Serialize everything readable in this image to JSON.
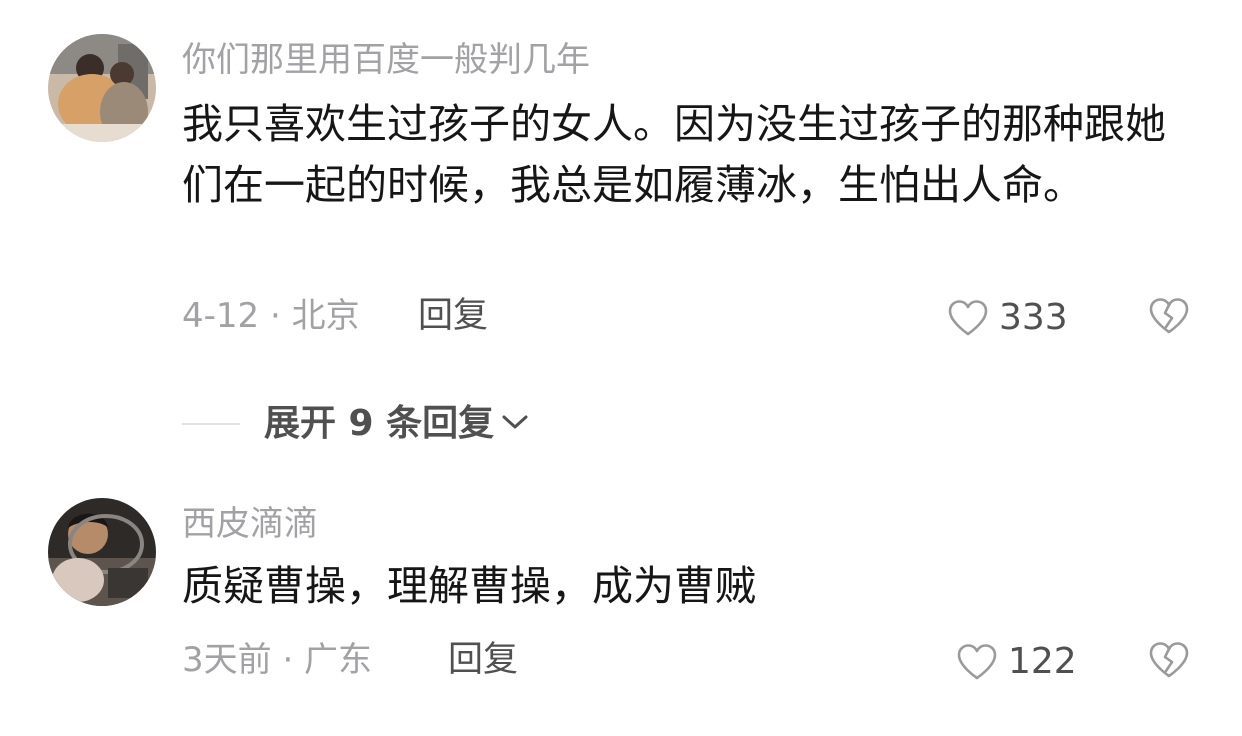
{
  "comments": [
    {
      "username": "你们那里用百度一般判几年",
      "content": "我只喜欢生过孩子的女人。因为没生过孩子的那种跟她们在一起的时候，我总是如履薄冰，生怕出人命。",
      "meta": "4-12 · 北京",
      "reply_label": "回复",
      "likes": "333"
    },
    {
      "username": "西皮滴滴",
      "content": "质疑曹操，理解曹操，成为曹贼",
      "meta": "3天前 · 广东",
      "reply_label": "回复",
      "likes": "122"
    }
  ],
  "expand": {
    "label": "展开 9 条回复"
  },
  "colors": {
    "meta": "#a2a2a6",
    "content": "#161616",
    "action": "#505050",
    "divider": "#e1e1e1"
  },
  "icons": [
    "heart-outline-icon",
    "broken-heart-icon",
    "chevron-down-icon"
  ]
}
